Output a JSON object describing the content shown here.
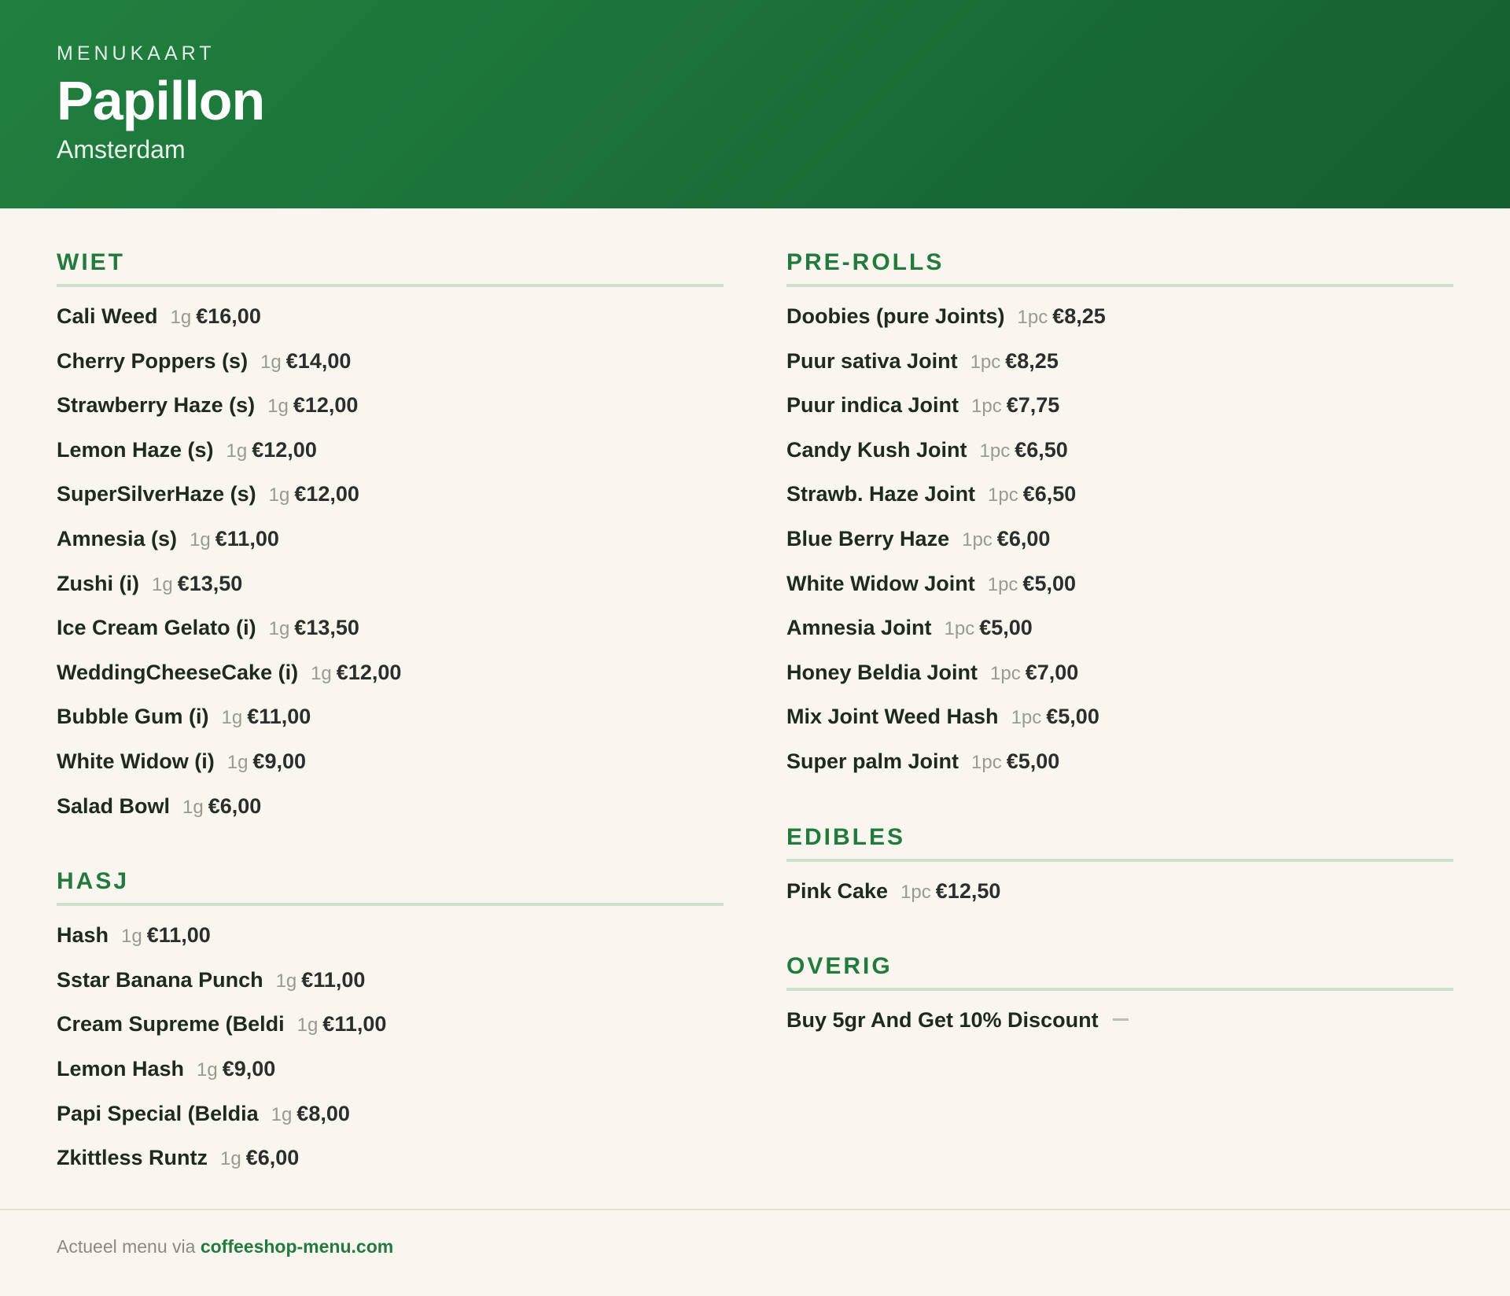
{
  "header": {
    "eyebrow": "MENUKAART",
    "shop_name": "Papillon",
    "city": "Amsterdam"
  },
  "sections": {
    "wiet": {
      "title": "WIET",
      "items": [
        {
          "name": "Cali Weed",
          "unit": "1g",
          "price": "€16,00"
        },
        {
          "name": "Cherry Poppers (s)",
          "unit": "1g",
          "price": "€14,00"
        },
        {
          "name": "Strawberry Haze (s)",
          "unit": "1g",
          "price": "€12,00"
        },
        {
          "name": "Lemon Haze (s)",
          "unit": "1g",
          "price": "€12,00"
        },
        {
          "name": "SuperSilverHaze (s)",
          "unit": "1g",
          "price": "€12,00"
        },
        {
          "name": "Amnesia (s)",
          "unit": "1g",
          "price": "€11,00"
        },
        {
          "name": "Zushi (i)",
          "unit": "1g",
          "price": "€13,50"
        },
        {
          "name": "Ice Cream Gelato (i)",
          "unit": "1g",
          "price": "€13,50"
        },
        {
          "name": "WeddingCheeseCake (i)",
          "unit": "1g",
          "price": "€12,00"
        },
        {
          "name": "Bubble Gum (i)",
          "unit": "1g",
          "price": "€11,00"
        },
        {
          "name": "White Widow (i)",
          "unit": "1g",
          "price": "€9,00"
        },
        {
          "name": "Salad Bowl",
          "unit": "1g",
          "price": "€6,00"
        }
      ]
    },
    "hasj": {
      "title": "HASJ",
      "items": [
        {
          "name": "Hash",
          "unit": "1g",
          "price": "€11,00"
        },
        {
          "name": "Sstar Banana Punch",
          "unit": "1g",
          "price": "€11,00"
        },
        {
          "name": "Cream Supreme (Beldi",
          "unit": "1g",
          "price": "€11,00"
        },
        {
          "name": "Lemon Hash",
          "unit": "1g",
          "price": "€9,00"
        },
        {
          "name": "Papi Special (Beldia",
          "unit": "1g",
          "price": "€8,00"
        },
        {
          "name": "Zkittless Runtz",
          "unit": "1g",
          "price": "€6,00"
        }
      ]
    },
    "prerolls": {
      "title": "PRE-ROLLS",
      "items": [
        {
          "name": "Doobies (pure Joints)",
          "unit": "1pc",
          "price": "€8,25"
        },
        {
          "name": "Puur sativa Joint",
          "unit": "1pc",
          "price": "€8,25"
        },
        {
          "name": "Puur indica Joint",
          "unit": "1pc",
          "price": "€7,75"
        },
        {
          "name": "Candy Kush Joint",
          "unit": "1pc",
          "price": "€6,50"
        },
        {
          "name": "Strawb. Haze Joint",
          "unit": "1pc",
          "price": "€6,50"
        },
        {
          "name": "Blue Berry Haze",
          "unit": "1pc",
          "price": "€6,00"
        },
        {
          "name": "White Widow Joint",
          "unit": "1pc",
          "price": "€5,00"
        },
        {
          "name": "Amnesia Joint",
          "unit": "1pc",
          "price": "€5,00"
        },
        {
          "name": "Honey Beldia Joint",
          "unit": "1pc",
          "price": "€7,00"
        },
        {
          "name": "Mix Joint Weed Hash",
          "unit": "1pc",
          "price": "€5,00"
        },
        {
          "name": "Super palm Joint",
          "unit": "1pc",
          "price": "€5,00"
        }
      ]
    },
    "edibles": {
      "title": "EDIBLES",
      "items": [
        {
          "name": "Pink Cake",
          "unit": "1pc",
          "price": "€12,50"
        }
      ]
    },
    "overig": {
      "title": "OVERIG",
      "items": [
        {
          "name": "Buy 5gr And Get 10% Discount",
          "unit": "",
          "price": ""
        }
      ]
    }
  },
  "footer": {
    "text": "Actueel menu via",
    "link": "coffeeshop-menu.com"
  },
  "colors": {
    "header_green": "#1a6e37",
    "accent_green": "#237a3e",
    "background": "#f8f6ee"
  }
}
